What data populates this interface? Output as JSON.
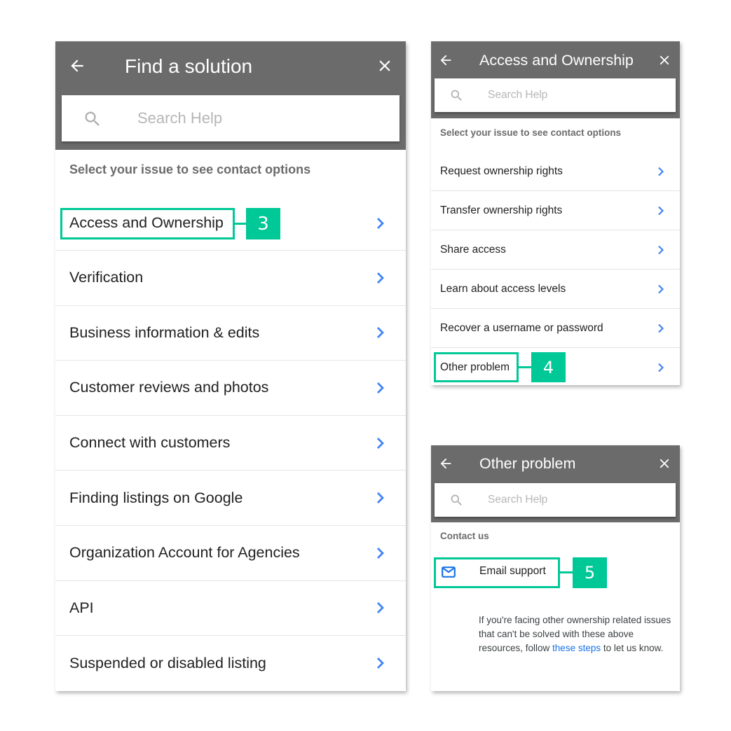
{
  "colors": {
    "header_bg": "#6b6b6b",
    "chevron": "#4285f4",
    "annotation": "#00c896",
    "link": "#1a73e8"
  },
  "panel_find": {
    "title": "Find a solution",
    "back_icon": "arrow-left-icon",
    "close_icon": "close-icon",
    "search": {
      "placeholder": "Search Help",
      "value": ""
    },
    "section_label": "Select your issue to see contact options",
    "items": [
      {
        "label": "Access and Ownership"
      },
      {
        "label": "Verification"
      },
      {
        "label": "Business information & edits"
      },
      {
        "label": "Customer reviews and photos"
      },
      {
        "label": "Connect with customers"
      },
      {
        "label": "Finding listings on Google"
      },
      {
        "label": "Organization Account for Agencies"
      },
      {
        "label": "API"
      },
      {
        "label": "Suspended or disabled listing"
      }
    ],
    "annotation": {
      "number": "3",
      "target": "Access and Ownership"
    }
  },
  "panel_access": {
    "title": "Access and Ownership",
    "search": {
      "placeholder": "Search Help",
      "value": ""
    },
    "section_label": "Select your issue to see contact options",
    "items": [
      {
        "label": "Request ownership rights"
      },
      {
        "label": "Transfer ownership rights"
      },
      {
        "label": "Share access"
      },
      {
        "label": "Learn about access levels"
      },
      {
        "label": "Recover a username or password"
      },
      {
        "label": "Other problem"
      }
    ],
    "annotation": {
      "number": "4",
      "target": "Other problem"
    }
  },
  "panel_other": {
    "title": "Other problem",
    "search": {
      "placeholder": "Search Help",
      "value": ""
    },
    "section_label": "Contact us",
    "email_label": "Email support",
    "info": {
      "before": "If you're facing other ownership related issues that can't be solved with these above resources, follow ",
      "link": "these steps",
      "after": " to let us know."
    },
    "annotation": {
      "number": "5",
      "target": "Email support"
    }
  }
}
